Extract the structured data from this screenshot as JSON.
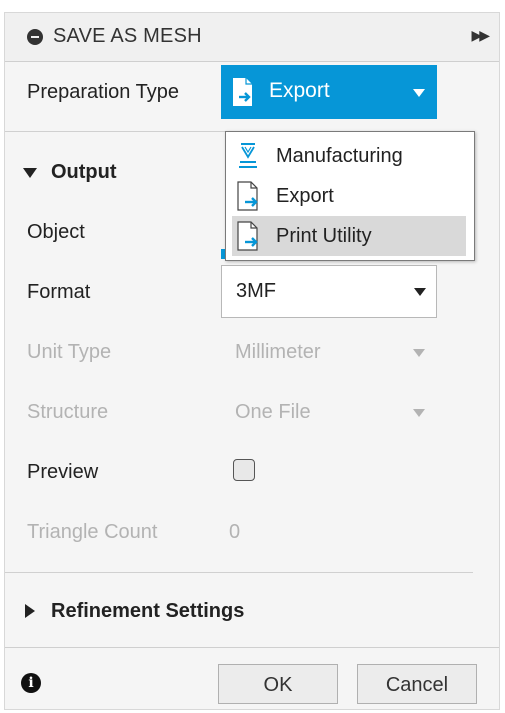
{
  "title": "SAVE AS MESH",
  "preparation": {
    "label": "Preparation Type",
    "selected": "Export",
    "options": [
      "Manufacturing",
      "Export",
      "Print Utility"
    ],
    "highlighted_option": "Print Utility"
  },
  "output": {
    "header": "Output",
    "object_label": "Object",
    "format_label": "Format",
    "format_value": "3MF",
    "unit_type_label": "Unit Type",
    "unit_type_value": "Millimeter",
    "structure_label": "Structure",
    "structure_value": "One File",
    "preview_label": "Preview",
    "preview_checked": false,
    "triangle_count_label": "Triangle Count",
    "triangle_count_value": "0"
  },
  "refinement": {
    "header": "Refinement Settings"
  },
  "footer": {
    "ok_label": "OK",
    "cancel_label": "Cancel"
  },
  "colors": {
    "accent": "#0696d7",
    "disabled_text": "#b3b3b3",
    "panel_bg": "#f5f5f5"
  },
  "icons": {
    "title": "collapse-minus-icon",
    "expand": "double-chevron-right-icon",
    "export": "export-document-icon",
    "manufacturing": "manufacturing-nozzle-icon",
    "print_utility": "print-utility-document-icon",
    "info": "info-icon"
  }
}
